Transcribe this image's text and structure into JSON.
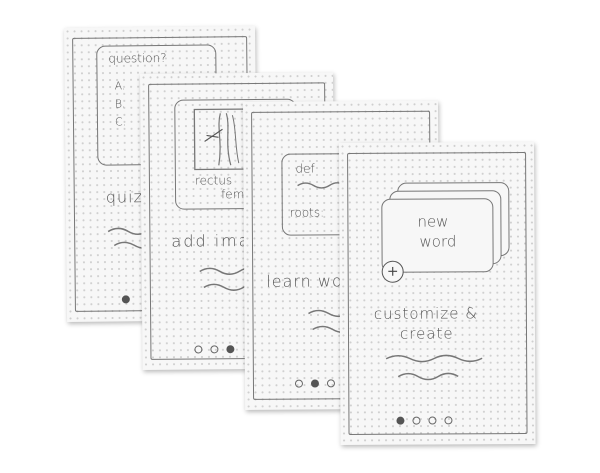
{
  "screens": [
    {
      "id": "quiz",
      "question": "question?",
      "options": [
        "A.",
        "B.",
        "C."
      ],
      "caption": "quiz"
    },
    {
      "id": "image",
      "image_label_line1": "rectus",
      "image_label_line2": "femoris",
      "caption": "add images"
    },
    {
      "id": "learn",
      "def_label": "def",
      "roots_label": "roots:",
      "caption": "learn words"
    },
    {
      "id": "customize",
      "card_title_line1": "new",
      "card_title_line2": "word",
      "add_symbol": "+",
      "caption_line1": "customize &",
      "caption_line2": "create"
    }
  ],
  "pagination": {
    "total": 4,
    "image_screen_active": 3,
    "learn_screen_active": 2,
    "customize_screen_active": 1
  }
}
